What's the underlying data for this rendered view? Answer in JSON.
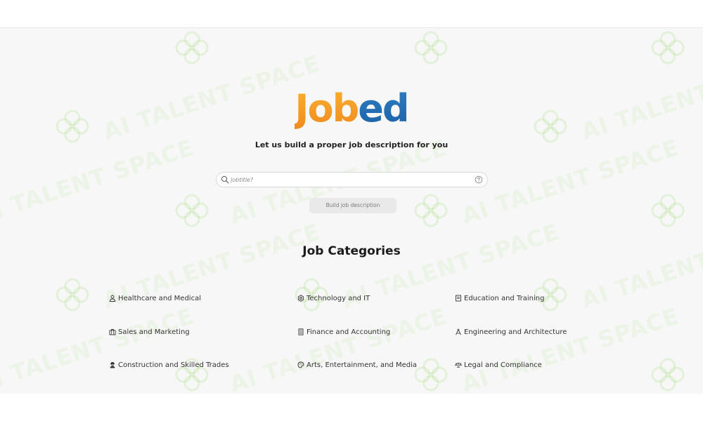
{
  "brand": {
    "logo_part_a": "Job",
    "logo_part_b": "ed",
    "colors": {
      "orange": "#f39a24",
      "blue": "#2470b6"
    }
  },
  "tagline": "Let us build a proper job description for you",
  "search": {
    "placeholder": "jobtitle?",
    "value": "",
    "left_icon": "search-icon",
    "right_icon": "help-circle-icon"
  },
  "build_button": {
    "label": "Build job description"
  },
  "categories_section": {
    "title": "Job Categories",
    "items": [
      {
        "label": "Healthcare and Medical",
        "icon": "person-icon"
      },
      {
        "label": "Technology and IT",
        "icon": "gear-icon"
      },
      {
        "label": "Education and Training",
        "icon": "book-icon"
      },
      {
        "label": "Sales and Marketing",
        "icon": "briefcase-icon"
      },
      {
        "label": "Finance and Accounting",
        "icon": "calculator-icon"
      },
      {
        "label": "Engineering and Architecture",
        "icon": "compass-icon"
      },
      {
        "label": "Construction and Skilled Trades",
        "icon": "worker-icon"
      },
      {
        "label": "Arts, Entertainment, and Media",
        "icon": "palette-icon"
      },
      {
        "label": "Legal and Compliance",
        "icon": "scale-icon"
      }
    ]
  },
  "watermark": {
    "text": "AI TALENT SPACE",
    "icon": "flower-logo-icon"
  }
}
